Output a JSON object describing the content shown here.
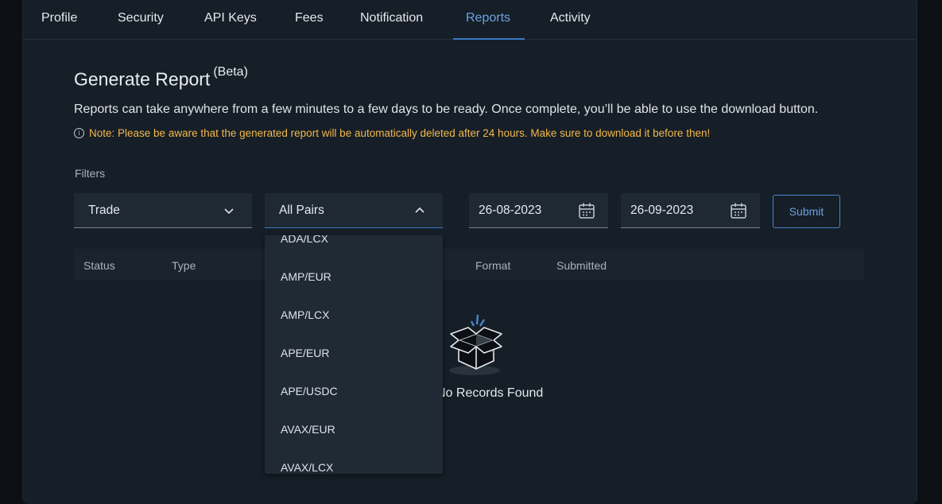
{
  "tabs": [
    "Profile",
    "Security",
    "API Keys",
    "Fees",
    "Notification",
    "Reports",
    "Activity"
  ],
  "active_tab": "Reports",
  "header": {
    "title": "Generate Report",
    "title_tag": "(Beta)",
    "description": "Reports can take anywhere from a few minutes to a few days to be ready. Once complete, you’ll be able to use the download button.",
    "note": "Note: Please be aware that the generated report will be automatically deleted after 24 hours. Make sure to download it before then!"
  },
  "filters": {
    "label": "Filters",
    "type_select": "Trade",
    "pair_select": "All Pairs",
    "date_from": "26-08-2023",
    "date_to": "26-09-2023",
    "submit_label": "Submit"
  },
  "table": {
    "columns": [
      "Status",
      "Type",
      "Format",
      "Submitted"
    ],
    "empty_text": "No Records Found"
  },
  "dropdown_options": [
    "ADA/LCX",
    "AMP/EUR",
    "AMP/LCX",
    "APE/EUR",
    "APE/USDC",
    "AVAX/EUR",
    "AVAX/LCX"
  ],
  "colors": {
    "accent": "#6aa3e0",
    "note": "#f2b84b",
    "background": "#161e27"
  }
}
